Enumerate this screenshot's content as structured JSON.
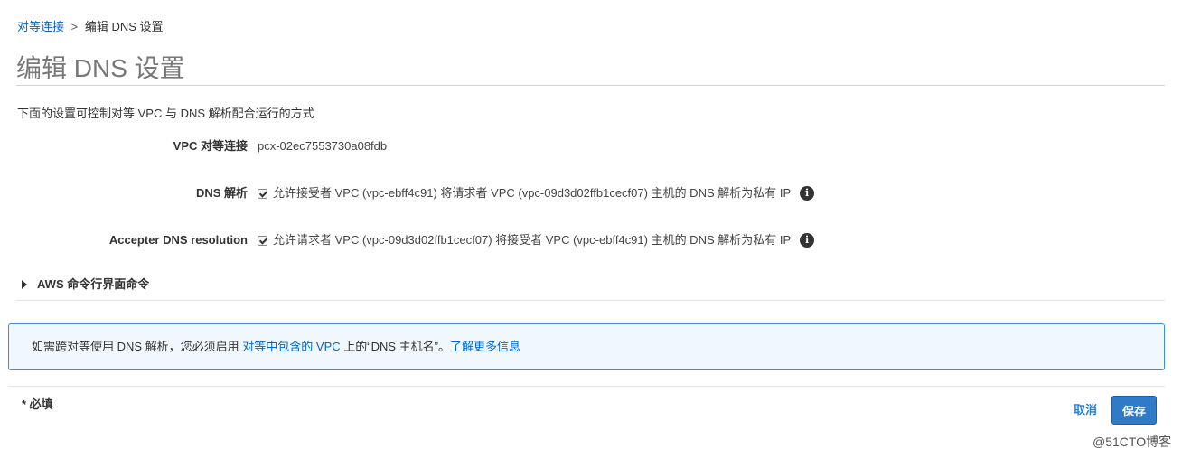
{
  "breadcrumb": {
    "parent": "对等连接",
    "separator": ">",
    "current": "编辑 DNS 设置"
  },
  "page": {
    "title": "编辑 DNS 设置",
    "description": "下面的设置可控制对等 VPC 与 DNS 解析配合运行的方式"
  },
  "form": {
    "peering": {
      "label": "VPC 对等连接",
      "value": "pcx-02ec7553730a08fdb"
    },
    "dns_resolution": {
      "label": "DNS 解析",
      "checked": true,
      "text": "允许接受者 VPC (vpc-ebff4c91) 将请求者 VPC (vpc-09d3d02ffb1cecf07) 主机的 DNS 解析为私有 IP"
    },
    "accepter_dns": {
      "label": "Accepter DNS resolution",
      "checked": true,
      "text": "允许请求者 VPC (vpc-09d3d02ffb1cecf07) 将接受者 VPC (vpc-ebff4c91) 主机的 DNS 解析为私有 IP"
    },
    "info_icon_char": "i"
  },
  "cli": {
    "label": "AWS 命令行界面命令"
  },
  "info_box": {
    "text_before": "如需跨对等使用 DNS 解析，您必须启用 ",
    "link_vpc": "对等中包含的 VPC",
    "text_after": " 上的“DNS 主机名”。",
    "link_more": "了解更多信息"
  },
  "footer": {
    "required_note": "* 必填",
    "cancel_label": "取消",
    "save_label": "保存"
  },
  "watermark": "@51CTO博客",
  "colors": {
    "link": "#0066cc",
    "primary_button": "#2f7bc8",
    "info_border": "#3b8dd1",
    "info_background": "#f1f8fd"
  }
}
